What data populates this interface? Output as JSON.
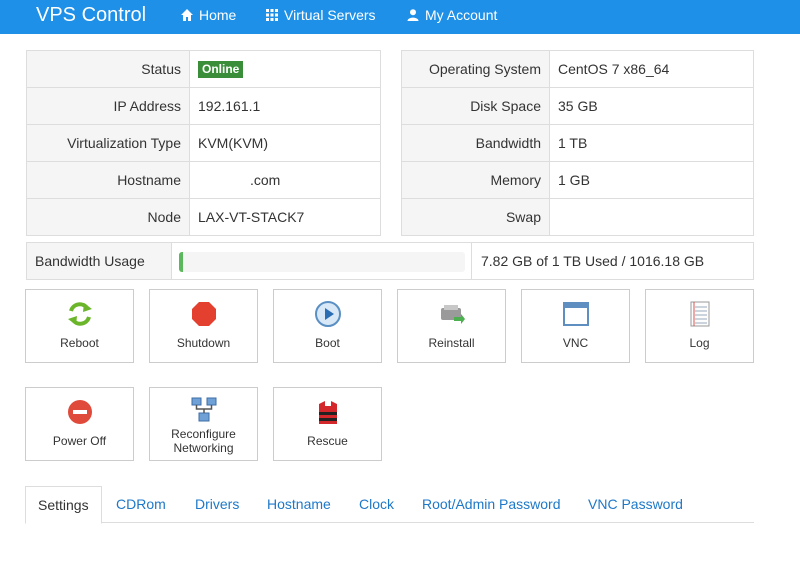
{
  "nav": {
    "brand": "VPS Control",
    "items": [
      {
        "label": "Home",
        "icon": "home-icon"
      },
      {
        "label": "Virtual Servers",
        "icon": "grid-icon"
      },
      {
        "label": "My Account",
        "icon": "user-icon"
      }
    ]
  },
  "info_left": [
    {
      "key": "Status",
      "value": "Online"
    },
    {
      "key": "IP Address",
      "value": "192.161.1"
    },
    {
      "key": "Virtualization Type",
      "value": "KVM(KVM)"
    },
    {
      "key": "Hostname",
      "value": ".com"
    },
    {
      "key": "Node",
      "value": "LAX-VT-STACK7"
    }
  ],
  "info_right": [
    {
      "key": "Operating System",
      "value": "CentOS 7 x86_64"
    },
    {
      "key": "Disk Space",
      "value": "35 GB"
    },
    {
      "key": "Bandwidth",
      "value": "1 TB"
    },
    {
      "key": "Memory",
      "value": "1 GB"
    },
    {
      "key": "Swap",
      "value": ""
    }
  ],
  "bandwidth": {
    "label": "Bandwidth Usage",
    "used_fraction": 0.0078,
    "text": "7.82 GB of 1 TB Used / 1016.18 GB"
  },
  "actions": [
    {
      "label": "Reboot",
      "icon": "reboot-icon"
    },
    {
      "label": "Shutdown",
      "icon": "shutdown-icon"
    },
    {
      "label": "Boot",
      "icon": "boot-icon"
    },
    {
      "label": "Reinstall",
      "icon": "reinstall-icon"
    },
    {
      "label": "VNC",
      "icon": "vnc-icon"
    },
    {
      "label": "Log",
      "icon": "log-icon"
    },
    {
      "label": "Power Off",
      "icon": "power-off-icon"
    },
    {
      "label": "Reconfigure Networking",
      "icon": "network-icon"
    },
    {
      "label": "Rescue",
      "icon": "rescue-icon"
    }
  ],
  "tabs": [
    "Settings",
    "CDRom",
    "Drivers",
    "Hostname",
    "Clock",
    "Root/Admin Password",
    "VNC Password"
  ],
  "colors": {
    "navbar": "#1e90e8",
    "online_badge": "#3a8e3a",
    "link": "#1e78c8",
    "progress": "#5cb85c"
  }
}
